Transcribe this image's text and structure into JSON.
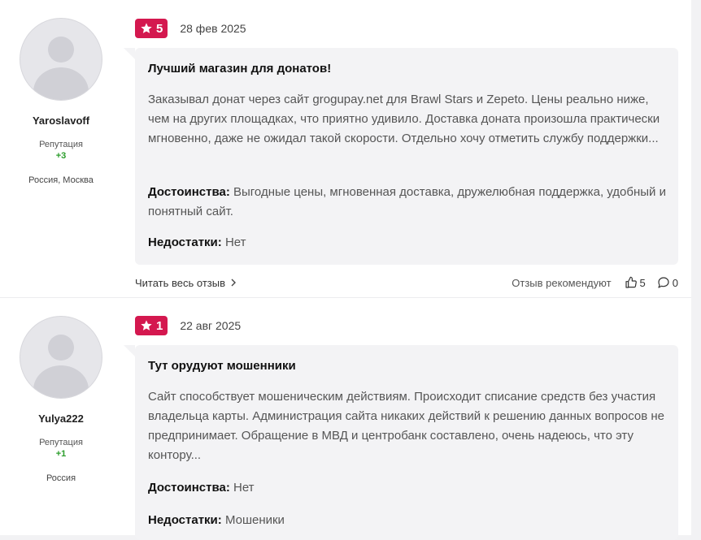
{
  "reviews": [
    {
      "author": {
        "name": "Yaroslavoff",
        "rep_label": "Репутация",
        "rep_value": "+3",
        "city": "Россия, Москва"
      },
      "rating": "5",
      "date": "28 фев 2025",
      "title": "Лучший магазин для донатов!",
      "text": "Заказывал донат через сайт grogupay.net для Brawl Stars и Zepeto. Цены реально ниже, чем на других площадках, что приятно удивило. Доставка доната произошла практически мгновенно, даже не ожидал такой скорости. Отдельно хочу отметить службу поддержки...",
      "pros_label": "Достоинства:",
      "pros": "Выгодные цены, мгновенная доставка, дружелюбная поддержка, удобный и понятный сайт.",
      "cons_label": "Недостатки:",
      "cons": "Нет",
      "read_more": "Читать весь отзыв",
      "recommends": "Отзыв рекомендуют",
      "likes": "5",
      "comments": "0"
    },
    {
      "author": {
        "name": "Yulya222",
        "rep_label": "Репутация",
        "rep_value": "+1",
        "city": "Россия"
      },
      "rating": "1",
      "date": "22 авг 2025",
      "title": "Тут орудуют мошенники",
      "text": "Сайт способствует мошеническим действиям. Происходит списание средств без участия владельца карты. Администрация сайта никаких действий к решению данных вопросов не предпринимает. Обращение в МВД и центробанк составлено, очень надеюсь, что эту контору...",
      "pros_label": "Достоинства:",
      "pros": "Нет",
      "cons_label": "Недостатки:",
      "cons": "Мошеники"
    }
  ],
  "colors": {
    "badge": "#d4184f",
    "reputation": "#2a9d2a",
    "bubble": "#f3f3f5"
  }
}
